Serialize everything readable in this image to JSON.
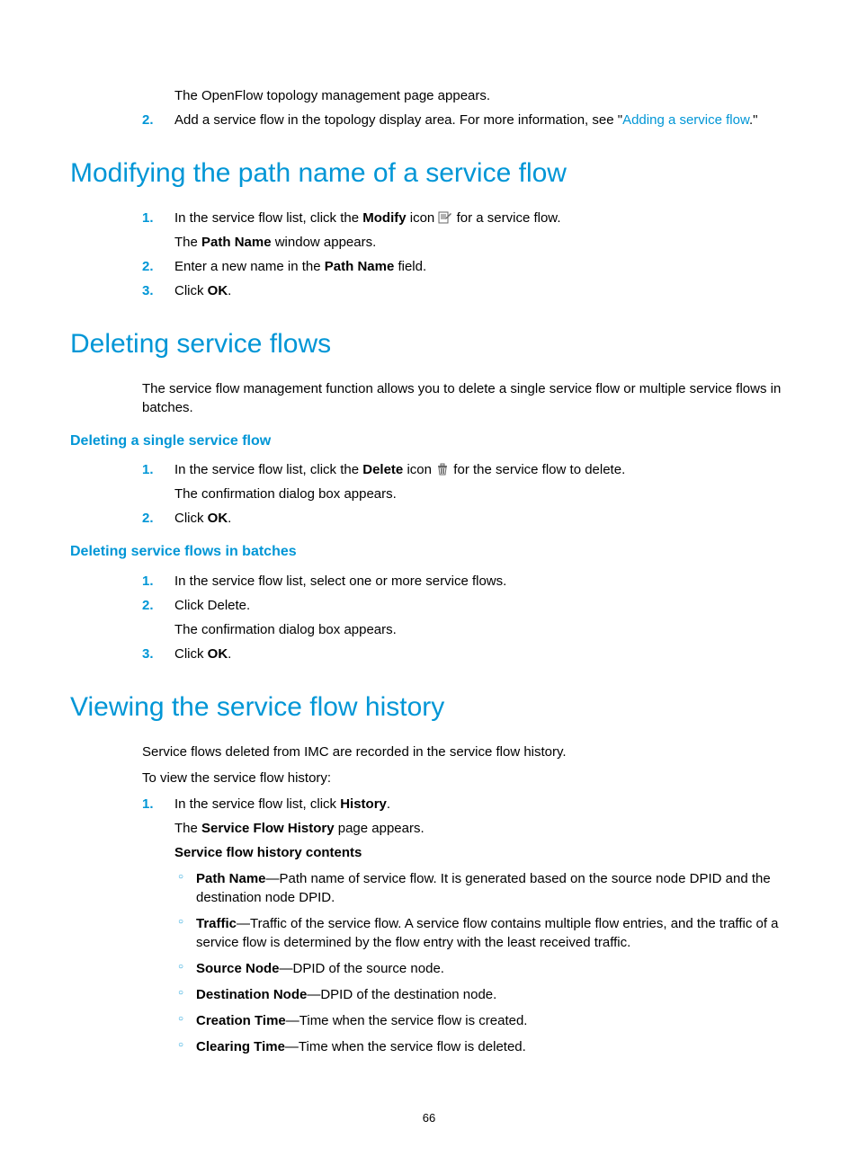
{
  "intro": {
    "line1": "The OpenFlow topology management page appears.",
    "step2_a": "Add a service flow in the topology display area. For more information, see \"",
    "step2_link": "Adding a service flow",
    "step2_b": ".\""
  },
  "sec1": {
    "heading": "Modifying the path name of a service flow",
    "s1a": "In the service flow list, click the ",
    "s1b": "Modify",
    "s1c": " icon ",
    "s1d": " for a service flow.",
    "s1e_a": "The ",
    "s1e_b": "Path Name",
    "s1e_c": " window appears.",
    "s2a": "Enter a new name in the ",
    "s2b": "Path Name",
    "s2c": " field.",
    "s3a": "Click ",
    "s3b": "OK",
    "s3c": "."
  },
  "sec2": {
    "heading": "Deleting service flows",
    "para": "The service flow management function allows you to delete a single service flow or multiple service flows in batches.",
    "sub1_heading": "Deleting a single service flow",
    "sub1_s1a": "In the service flow list, click the ",
    "sub1_s1b": "Delete",
    "sub1_s1c": " icon ",
    "sub1_s1d": " for the service flow to delete.",
    "sub1_s1e": "The confirmation dialog box appears.",
    "sub1_s2a": "Click ",
    "sub1_s2b": "OK",
    "sub1_s2c": ".",
    "sub2_heading": "Deleting service flows in batches",
    "sub2_s1": "In the service flow list, select one or more service flows.",
    "sub2_s2": "Click Delete.",
    "sub2_s2b": "The confirmation dialog box appears.",
    "sub2_s3a": "Click ",
    "sub2_s3b": "OK",
    "sub2_s3c": "."
  },
  "sec3": {
    "heading": "Viewing the service flow history",
    "p1": "Service flows deleted from IMC are recorded in the service flow history.",
    "p2": "To view the service flow history:",
    "s1a": "In the service flow list, click ",
    "s1b": "History",
    "s1c": ".",
    "s1d_a": "The ",
    "s1d_b": "Service Flow History",
    "s1d_c": " page appears.",
    "s1e": "Service flow history contents",
    "b1a": "Path Name",
    "b1b": "—Path name of service flow. It is generated based on the source node DPID and the destination node DPID.",
    "b2a": "Traffic",
    "b2b": "—Traffic of the service flow. A service flow contains multiple flow entries, and the traffic of a service flow is determined by the flow entry with the least received traffic.",
    "b3a": "Source Node",
    "b3b": "—DPID of the source node.",
    "b4a": "Destination Node",
    "b4b": "—DPID of the destination node.",
    "b5a": "Creation Time",
    "b5b": "—Time when the service flow is created.",
    "b6a": "Clearing Time",
    "b6b": "—Time when the service flow is deleted."
  },
  "page_number": "66"
}
